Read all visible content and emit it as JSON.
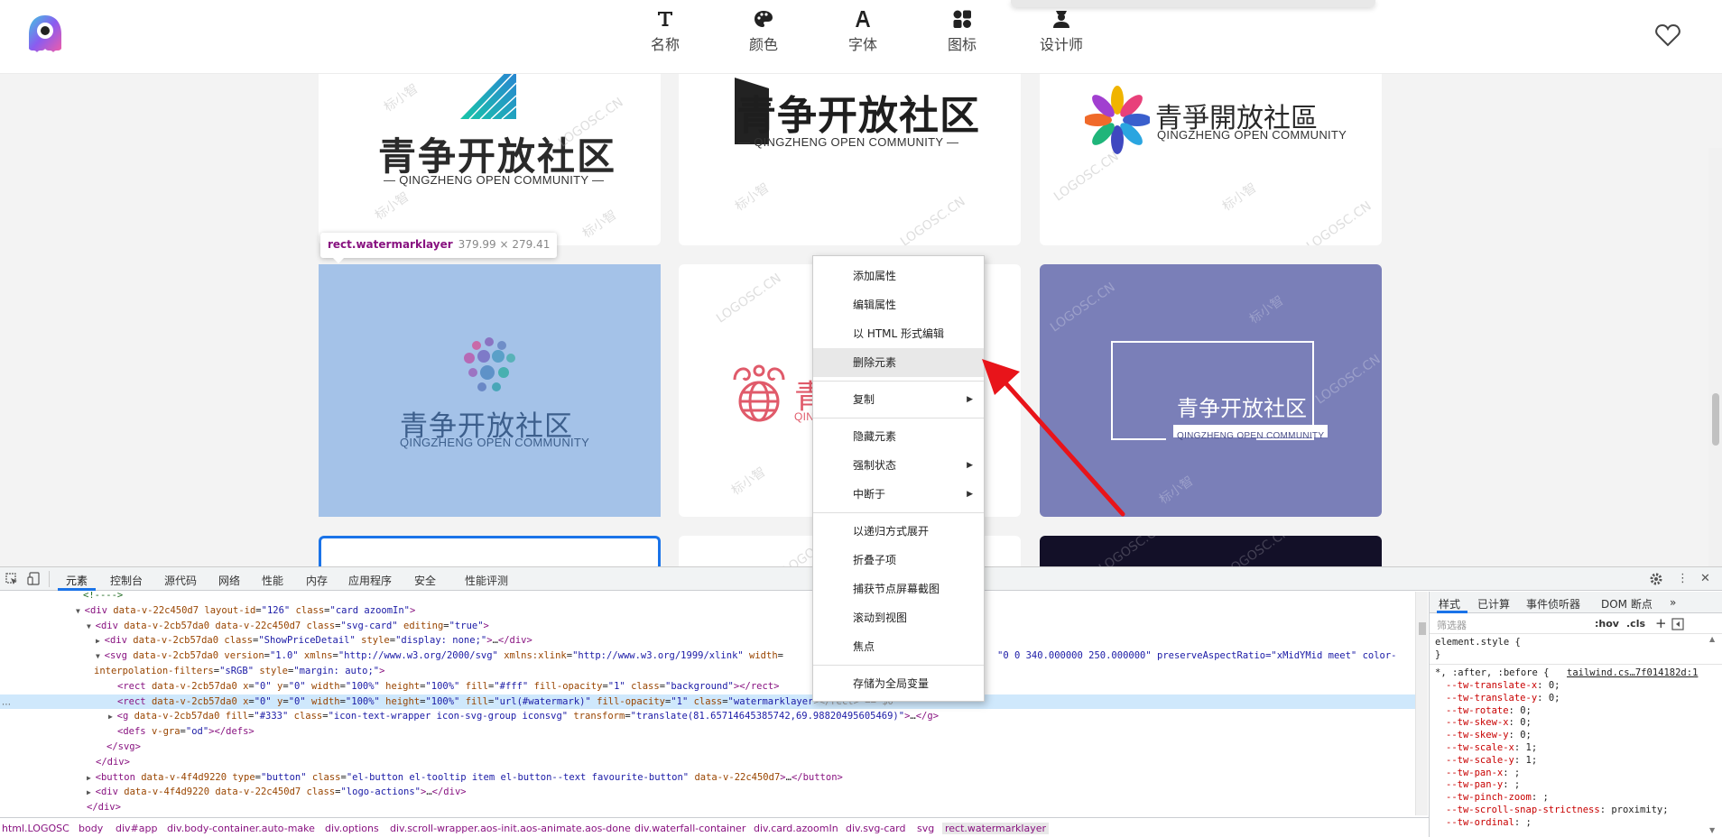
{
  "nav": {
    "items": [
      {
        "label": "名称",
        "icon": "text-T-icon"
      },
      {
        "label": "颜色",
        "icon": "palette-icon"
      },
      {
        "label": "字体",
        "icon": "font-A-icon"
      },
      {
        "label": "图标",
        "icon": "shapes-icon"
      },
      {
        "label": "设计师",
        "icon": "designer-icon"
      }
    ],
    "favorite_icon": "heart-icon"
  },
  "gallery": {
    "watermark_cn": "标小智",
    "watermark_en": "LOGOSC.CN",
    "cards": [
      {
        "cn": "青争开放社区",
        "en": "— QINGZHENG OPEN COMMUNITY —"
      },
      {
        "cn": "青争开放社区",
        "en": "— QINGZHENG OPEN COMMUNITY —"
      },
      {
        "cn": "青爭開放社區",
        "en": "QINGZHENG OPEN COMMUNITY"
      },
      {
        "cn": "青争开放社区",
        "en": "QINGZHENG OPEN COMMUNITY"
      },
      {
        "cn": "青",
        "en": "QIN"
      },
      {
        "cn": "青争开放社区",
        "en": "QINGZHENG OPEN COMMUNITY"
      }
    ],
    "colors": {
      "highlight": "#a4c2e8",
      "purple": "#7a7fb8",
      "dark": "#131028",
      "selected_border": "#1a73e8"
    }
  },
  "tooltip": {
    "selector": "rect.watermarklayer",
    "dims": "379.99 × 279.41"
  },
  "context_menu": {
    "items": [
      "添加属性",
      "编辑属性",
      "以 HTML 形式编辑",
      "删除元素",
      "复制",
      "隐藏元素",
      "强制状态",
      "中断于",
      "以递归方式展开",
      "折叠子项",
      "捕获节点屏幕截图",
      "滚动到视图",
      "焦点",
      "存储为全局变量"
    ],
    "highlighted": "删除元素",
    "arrow_color": "#e8141a"
  },
  "devtools": {
    "tabs": [
      "元素",
      "控制台",
      "源代码",
      "网络",
      "性能",
      "内存",
      "应用程序",
      "安全",
      "性能评测"
    ],
    "lines": [
      {
        "parts": [
          [
            "cm",
            "<!---->"
          ]
        ]
      },
      {
        "tri": "▼",
        "parts": [
          [
            "tg",
            "<div "
          ],
          [
            "at",
            "data-v-22c450d7 layout-id"
          ],
          [
            "tx",
            "="
          ],
          [
            "av",
            "\"126\""
          ],
          [
            "at",
            " class"
          ],
          [
            "tx",
            "="
          ],
          [
            "av",
            "\"card azoomIn\""
          ],
          [
            "tg",
            ">"
          ]
        ]
      },
      {
        "tri": "▼",
        "parts": [
          [
            "tg",
            "<div "
          ],
          [
            "at",
            "data-v-2cb57da0 data-v-22c450d7 class"
          ],
          [
            "tx",
            "="
          ],
          [
            "av",
            "\"svg-card\""
          ],
          [
            "at",
            " editing"
          ],
          [
            "tx",
            "="
          ],
          [
            "av",
            "\"true\""
          ],
          [
            "tg",
            ">"
          ]
        ]
      },
      {
        "tri": "▶",
        "parts": [
          [
            "tg",
            "<div "
          ],
          [
            "at",
            "data-v-2cb57da0 class"
          ],
          [
            "tx",
            "="
          ],
          [
            "av",
            "\"ShowPriceDetail\""
          ],
          [
            "at",
            " style"
          ],
          [
            "tx",
            "="
          ],
          [
            "av",
            "\"display: none;\""
          ],
          [
            "tg",
            ">"
          ],
          [
            "tx",
            "…"
          ],
          [
            "tg",
            "</div>"
          ]
        ]
      },
      {
        "tri": "▼",
        "parts": [
          [
            "tg",
            "<svg "
          ],
          [
            "at",
            "data-v-2cb57da0 version"
          ],
          [
            "tx",
            "="
          ],
          [
            "av",
            "\"1.0\""
          ],
          [
            "at",
            " xmlns"
          ],
          [
            "tx",
            "="
          ],
          [
            "av",
            "\"http://www.w3.org/2000/svg\""
          ],
          [
            "at",
            " xmlns:xlink"
          ],
          [
            "tx",
            "="
          ],
          [
            "av",
            "\"http://www.w3.org/1999/xlink\""
          ],
          [
            "at",
            " width"
          ],
          [
            "tx",
            "="
          ]
        ]
      },
      {
        "parts": [
          [
            "at",
            "interpolation-filters"
          ],
          [
            "tx",
            "="
          ],
          [
            "av",
            "\"sRGB\""
          ],
          [
            "at",
            " style"
          ],
          [
            "tx",
            "="
          ],
          [
            "av",
            "\"margin: auto;\""
          ],
          [
            "tg",
            ">"
          ]
        ]
      },
      {
        "parts": [
          [
            "tg",
            "<rect "
          ],
          [
            "at",
            "data-v-2cb57da0 x"
          ],
          [
            "tx",
            "="
          ],
          [
            "av",
            "\"0\""
          ],
          [
            "at",
            " y"
          ],
          [
            "tx",
            "="
          ],
          [
            "av",
            "\"0\""
          ],
          [
            "at",
            " width"
          ],
          [
            "tx",
            "="
          ],
          [
            "av",
            "\"100%\""
          ],
          [
            "at",
            " height"
          ],
          [
            "tx",
            "="
          ],
          [
            "av",
            "\"100%\""
          ],
          [
            "at",
            " fill"
          ],
          [
            "tx",
            "="
          ],
          [
            "av",
            "\"#fff\""
          ],
          [
            "at",
            " fill-opacity"
          ],
          [
            "tx",
            "="
          ],
          [
            "av",
            "\"1\""
          ],
          [
            "at",
            " class"
          ],
          [
            "tx",
            "="
          ],
          [
            "av",
            "\"background\""
          ],
          [
            "tg",
            "></rect>"
          ]
        ]
      },
      {
        "sel": true,
        "parts": [
          [
            "tg",
            "<rect "
          ],
          [
            "at",
            "data-v-2cb57da0 x"
          ],
          [
            "tx",
            "="
          ],
          [
            "av",
            "\"0\""
          ],
          [
            "at",
            " y"
          ],
          [
            "tx",
            "="
          ],
          [
            "av",
            "\"0\""
          ],
          [
            "at",
            " width"
          ],
          [
            "tx",
            "="
          ],
          [
            "av",
            "\"100%\""
          ],
          [
            "at",
            " height"
          ],
          [
            "tx",
            "="
          ],
          [
            "av",
            "\"100%\""
          ],
          [
            "at",
            " fill"
          ],
          [
            "tx",
            "="
          ],
          [
            "av",
            "\"url(#watermark)\""
          ],
          [
            "at",
            " fill-opacity"
          ],
          [
            "tx",
            "="
          ],
          [
            "av",
            "\"1\""
          ],
          [
            "at",
            " class"
          ],
          [
            "tx",
            "="
          ],
          [
            "av",
            "\"watermarklayer"
          ]
        ]
      },
      {
        "tri": "▶",
        "parts": [
          [
            "tg",
            "<g "
          ],
          [
            "at",
            "data-v-2cb57da0 fill"
          ],
          [
            "tx",
            "="
          ],
          [
            "av",
            "\"#333\""
          ],
          [
            "at",
            " class"
          ],
          [
            "tx",
            "="
          ],
          [
            "av",
            "\"icon-text-wrapper icon-svg-group iconsvg\""
          ],
          [
            "at",
            " transform"
          ],
          [
            "tx",
            "="
          ],
          [
            "av",
            "\"translate(81.65714645385742,69.98820495605469)\""
          ],
          [
            "tg",
            ">"
          ],
          [
            "tx",
            "…"
          ],
          [
            "tg",
            "</g>"
          ]
        ]
      },
      {
        "parts": [
          [
            "tg",
            "<defs "
          ],
          [
            "at",
            "v-gra"
          ],
          [
            "tx",
            "="
          ],
          [
            "av",
            "\"od\""
          ],
          [
            "tg",
            "></defs>"
          ]
        ]
      },
      {
        "parts": [
          [
            "tg",
            "</svg>"
          ]
        ]
      },
      {
        "parts": [
          [
            "tg",
            "</div>"
          ]
        ]
      },
      {
        "tri": "▶",
        "parts": [
          [
            "tg",
            "<button "
          ],
          [
            "at",
            "data-v-4f4d9220 type"
          ],
          [
            "tx",
            "="
          ],
          [
            "av",
            "\"button\""
          ],
          [
            "at",
            " class"
          ],
          [
            "tx",
            "="
          ],
          [
            "av",
            "\"el-button el-tooltip item el-button--text favourite-button\""
          ],
          [
            "at",
            " data-v-22c450d7"
          ],
          [
            "tg",
            ">"
          ],
          [
            "tx",
            "…"
          ],
          [
            "tg",
            "</button>"
          ]
        ]
      },
      {
        "tri": "▶",
        "parts": [
          [
            "tg",
            "<div "
          ],
          [
            "at",
            "data-v-4f4d9220 data-v-22c450d7 class"
          ],
          [
            "tx",
            "="
          ],
          [
            "av",
            "\"logo-actions\""
          ],
          [
            "tg",
            ">"
          ],
          [
            "tx",
            "…"
          ],
          [
            "tg",
            "</div>"
          ]
        ]
      },
      {
        "parts": [
          [
            "tg",
            "</div>"
          ]
        ]
      }
    ],
    "line_tail_4": "\"0 0 340.000000 250.000000\" preserveAspectRatio=\"xMidYMid meet\" color-",
    "line_tail_7": "></rect> == $0",
    "breadcrumbs": [
      "html.LOGOSC",
      "body",
      "div#app",
      "div.body-container.auto-make",
      "div.options",
      "div.scroll-wrapper.aos-init.aos-animate.aos-done",
      "div.waterfall-container",
      "div.card.azoomIn",
      "div.svg-card",
      "svg",
      "rect.watermarklayer"
    ],
    "side_tabs": [
      "样式",
      "已计算",
      "事件侦听器",
      "DOM 断点",
      "»"
    ],
    "filter_placeholder": "筛选器",
    "filter_hov": ":hov",
    "filter_cls": ".cls",
    "filter_plus": "+",
    "rules_header": "element.style {",
    "rules_close": "}",
    "rule_selector": "*, :after, :before {",
    "rule_source": "tailwind.cs…7f014182d:1",
    "rule_props": [
      [
        "--tw-translate-x",
        "0;"
      ],
      [
        "--tw-translate-y",
        "0;"
      ],
      [
        "--tw-rotate",
        "0;"
      ],
      [
        "--tw-skew-x",
        "0;"
      ],
      [
        "--tw-skew-y",
        "0;"
      ],
      [
        "--tw-scale-x",
        "1;"
      ],
      [
        "--tw-scale-y",
        "1;"
      ],
      [
        "--tw-pan-x",
        ";"
      ],
      [
        "--tw-pan-y",
        ";"
      ],
      [
        "--tw-pinch-zoom",
        ";"
      ],
      [
        "--tw-scroll-snap-strictness",
        "proximity;"
      ],
      [
        "--tw-ordinal",
        ";"
      ]
    ]
  }
}
